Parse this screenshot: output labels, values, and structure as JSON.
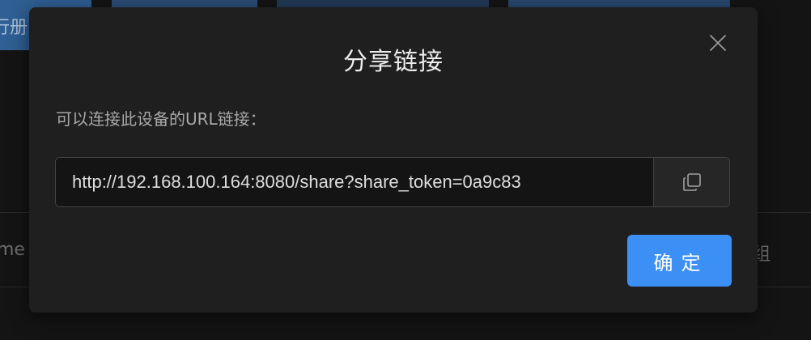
{
  "background": {
    "toolbar_button_label": "行册",
    "row_text_left": "me",
    "row_text_right": "组"
  },
  "modal": {
    "title": "分享链接",
    "description": "可以连接此设备的URL链接：",
    "share_url": "http://192.168.100.164:8080/share?share_token=0a9c83",
    "confirm_label": "确定"
  },
  "icons": {
    "close": "close-icon",
    "copy": "copy-icon"
  },
  "colors": {
    "accent": "#3c8ff5",
    "modal_bg": "#1f1f1f",
    "page_bg": "#141414"
  }
}
